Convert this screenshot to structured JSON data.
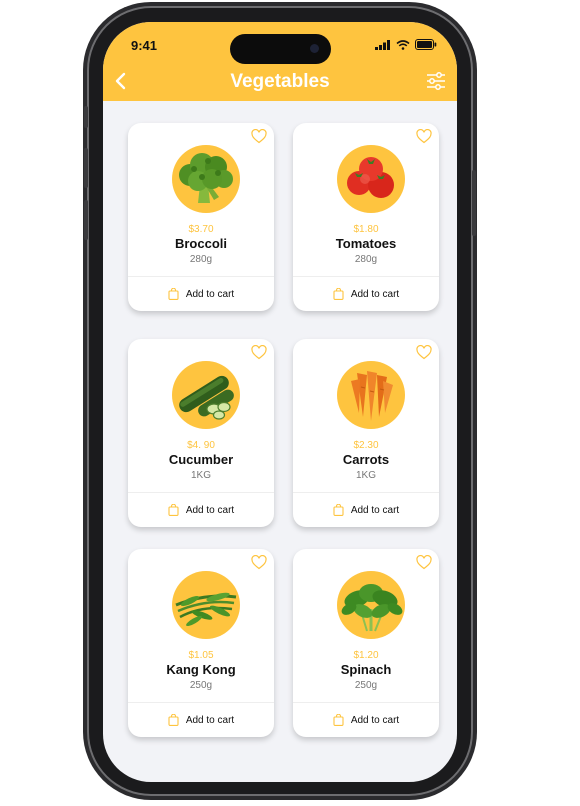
{
  "status_bar": {
    "time": "9:41"
  },
  "header": {
    "title": "Vegetables",
    "back_icon": "chevron-left-icon",
    "filter_icon": "sliders-icon",
    "color": "#fec43f"
  },
  "colors": {
    "accent": "#fec43f",
    "background": "#f2f3f7",
    "card": "#ffffff"
  },
  "products": [
    {
      "price": "$3.70",
      "name": "Broccoli",
      "weight": "280g",
      "cart_label": "Add to cart",
      "image": "broccoli"
    },
    {
      "price": "$1.80",
      "name": "Tomatoes",
      "weight": "280g",
      "cart_label": "Add to cart",
      "image": "tomatoes"
    },
    {
      "price": "$4. 90",
      "name": "Cucumber",
      "weight": "1KG",
      "cart_label": "Add to cart",
      "image": "cucumber"
    },
    {
      "price": "$2.30",
      "name": "Carrots",
      "weight": "1KG",
      "cart_label": "Add to cart",
      "image": "carrots"
    },
    {
      "price": "$1.05",
      "name": "Kang Kong",
      "weight": "250g",
      "cart_label": "Add to cart",
      "image": "kang-kong"
    },
    {
      "price": "$1.20",
      "name": "Spinach",
      "weight": "250g",
      "cart_label": "Add to cart",
      "image": "spinach"
    }
  ]
}
